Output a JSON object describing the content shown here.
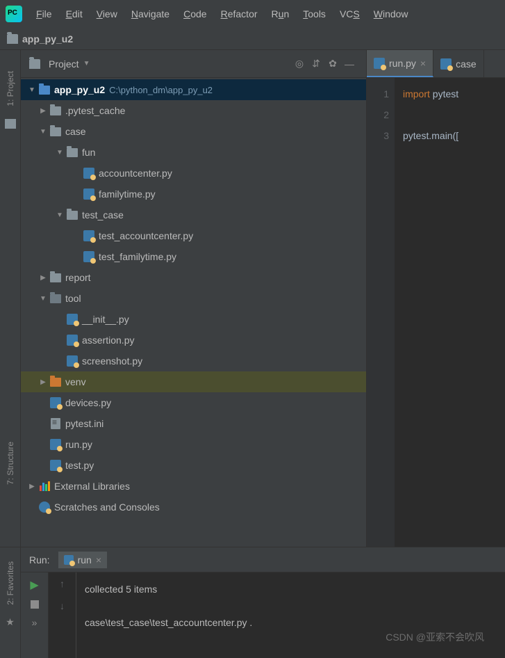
{
  "menu": {
    "items": [
      {
        "label": "File",
        "ul": "F"
      },
      {
        "label": "Edit",
        "ul": "E"
      },
      {
        "label": "View",
        "ul": "V"
      },
      {
        "label": "Navigate",
        "ul": "N"
      },
      {
        "label": "Code",
        "ul": "C"
      },
      {
        "label": "Refactor",
        "ul": "R"
      },
      {
        "label": "Run",
        "ul": "u"
      },
      {
        "label": "Tools",
        "ul": "T"
      },
      {
        "label": "VCS",
        "ul": "S"
      },
      {
        "label": "Window",
        "ul": "W"
      }
    ]
  },
  "breadcrumb": {
    "project_name": "app_py_u2"
  },
  "sidebar": {
    "project_label": "1: Project",
    "structure_label": "7: Structure",
    "favorites_label": "2: Favorites"
  },
  "project_panel": {
    "title": "Project"
  },
  "tree": {
    "root": {
      "name": "app_py_u2",
      "path": "C:\\python_dm\\app_py_u2"
    },
    "nodes": [
      {
        "label": ".pytest_cache",
        "type": "folder",
        "indent": 1,
        "chev": "right"
      },
      {
        "label": "case",
        "type": "folder",
        "indent": 1,
        "chev": "down"
      },
      {
        "label": "fun",
        "type": "folder",
        "indent": 2,
        "chev": "down"
      },
      {
        "label": "accountcenter.py",
        "type": "pyfile",
        "indent": 3,
        "chev": "none"
      },
      {
        "label": "familytime.py",
        "type": "pyfile",
        "indent": 3,
        "chev": "none"
      },
      {
        "label": "test_case",
        "type": "folder",
        "indent": 2,
        "chev": "down"
      },
      {
        "label": "test_accountcenter.py",
        "type": "pyfile",
        "indent": 3,
        "chev": "none"
      },
      {
        "label": "test_familytime.py",
        "type": "pyfile",
        "indent": 3,
        "chev": "none"
      },
      {
        "label": "report",
        "type": "folder",
        "indent": 1,
        "chev": "right"
      },
      {
        "label": "tool",
        "type": "folder-dot",
        "indent": 1,
        "chev": "down"
      },
      {
        "label": "__init__.py",
        "type": "pyfile",
        "indent": 2,
        "chev": "none"
      },
      {
        "label": "assertion.py",
        "type": "pyfile",
        "indent": 2,
        "chev": "none"
      },
      {
        "label": "screenshot.py",
        "type": "pyfile",
        "indent": 2,
        "chev": "none"
      },
      {
        "label": "venv",
        "type": "folder-orange",
        "indent": 1,
        "chev": "right",
        "hover": true
      },
      {
        "label": "devices.py",
        "type": "pyfile",
        "indent": 1,
        "chev": "none"
      },
      {
        "label": "pytest.ini",
        "type": "inifile",
        "indent": 1,
        "chev": "none"
      },
      {
        "label": "run.py",
        "type": "pyfile",
        "indent": 1,
        "chev": "none"
      },
      {
        "label": "test.py",
        "type": "pyfile",
        "indent": 1,
        "chev": "none"
      }
    ],
    "external": "External Libraries",
    "scratches": "Scratches and Consoles"
  },
  "editor": {
    "tabs": [
      {
        "label": "run.py",
        "active": true
      },
      {
        "label": "case",
        "active": false
      }
    ],
    "lines": [
      "1",
      "2",
      "3"
    ],
    "code": {
      "l1_kw": "import",
      "l1_mod": "pytest",
      "l3_obj": "pytest",
      "l3_call": ".main(["
    }
  },
  "run": {
    "title": "Run:",
    "tab": "run",
    "out1": "collected 5 items",
    "out2": "case\\test_case\\test_accountcenter.py ."
  },
  "watermark": "CSDN @亚索不会吹风"
}
